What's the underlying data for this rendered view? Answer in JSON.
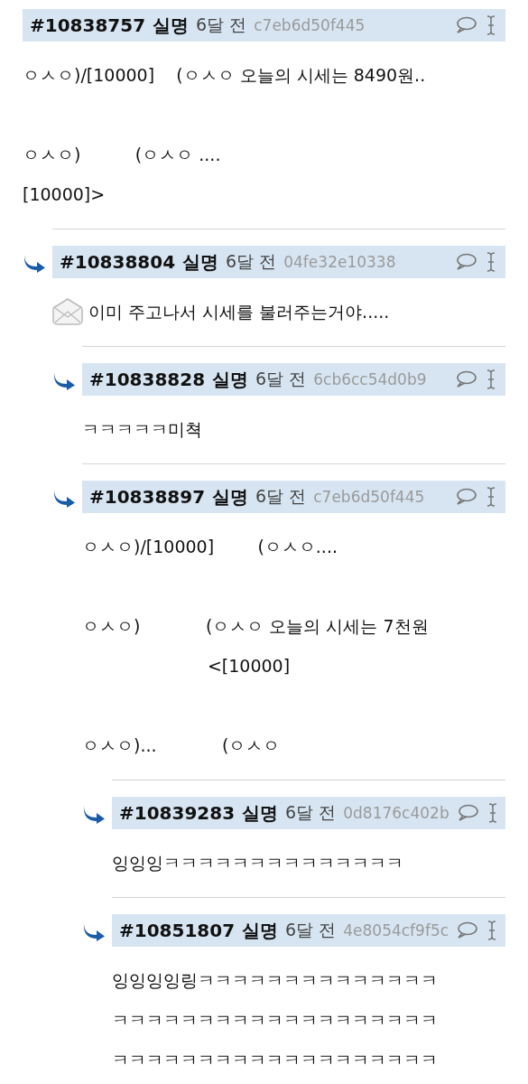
{
  "comments": [
    {
      "number": "#10838757",
      "author": "실명",
      "time": "6달 전",
      "hash": "c7eb6d50f445",
      "kind": "plain",
      "paragraphs": [
        [
          "ㅇㅅㅇ)/[10000]    (ㅇㅅㅇ 오늘의 시세는 8490원.."
        ],
        [
          "ㅇㅅㅇ)          (ㅇㅅㅇ ....",
          "[10000]>"
        ]
      ],
      "children": [
        {
          "number": "#10838804",
          "author": "실명",
          "time": "6달 전",
          "hash": "04fe32e10338",
          "kind": "envelope",
          "paragraphs": [
            [
              "이미 주고나서 시세를 불러주는거야....."
            ]
          ],
          "children": [
            {
              "number": "#10838828",
              "author": "실명",
              "time": "6달 전",
              "hash": "6cb6cc54d0b9",
              "kind": "plain",
              "paragraphs": [
                [
                  "ㅋㅋㅋㅋㅋ미쳑"
                ]
              ]
            },
            {
              "number": "#10838897",
              "author": "실명",
              "time": "6달 전",
              "hash": "c7eb6d50f445",
              "kind": "plain",
              "paragraphs": [
                [
                  "ㅇㅅㅇ)/[10000]        (ㅇㅅㅇ...."
                ],
                [
                  "ㅇㅅㅇ)            (ㅇㅅㅇ 오늘의 시세는 7천원",
                  "                       <[10000]"
                ],
                [
                  "ㅇㅅㅇ)...            (ㅇㅅㅇ"
                ]
              ],
              "children": [
                {
                  "number": "#10839283",
                  "author": "실명",
                  "time": "6달 전",
                  "hash": "0d8176c402b",
                  "kind": "plain",
                  "paragraphs": [
                    [
                      "잉잉잉ㅋㅋㅋㅋㅋㅋㅋㅋㅋㅋㅋㅋㅋㅋ"
                    ]
                  ]
                },
                {
                  "number": "#10851807",
                  "author": "실명",
                  "time": "6달 전",
                  "hash": "4e8054cf9f5c",
                  "kind": "plain",
                  "paragraphs": [
                    [
                      "잉잉잉잉링ㅋㅋㅋㅋㅋㅋㅋㅋㅋㅋㅋㅋㅋㅋ",
                      "ㅋㅋㅋㅋㅋㅋㅋㅋㅋㅋㅋㅋㅋㅋㅋㅋㅋㅋㅋ",
                      "ㅋㅋㅋㅋㅋㅋㅋㅋㅋㅋㅋㅋㅋㅋㅋㅋㅋㅋㅋ"
                    ]
                  ]
                }
              ]
            }
          ]
        }
      ]
    }
  ]
}
